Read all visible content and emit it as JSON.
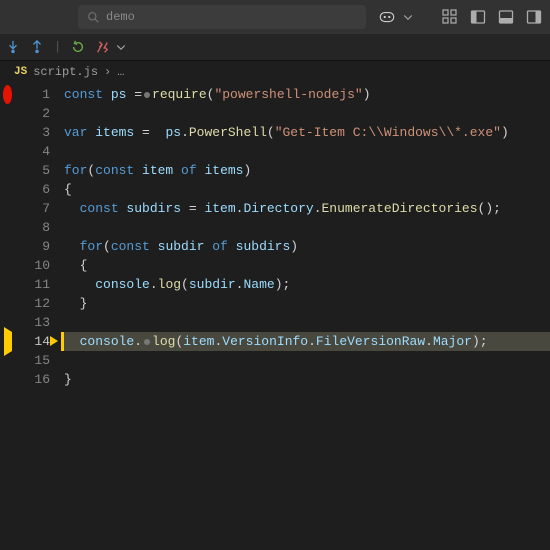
{
  "top": {
    "search_placeholder": "demo",
    "copilot_icon": "copilot-icon"
  },
  "debug_toolbar": {
    "items": [
      "step-into",
      "step-out",
      "restart",
      "disconnect"
    ]
  },
  "breadcrumb": {
    "file_icon": "JS",
    "file_name": "script.js",
    "separator": "›",
    "more": "…"
  },
  "editor": {
    "line_numbers": [
      "1",
      "2",
      "3",
      "4",
      "5",
      "6",
      "7",
      "8",
      "9",
      "10",
      "11",
      "12",
      "13",
      "14",
      "15",
      "16"
    ],
    "current_line": 14,
    "breakpoints": {
      "1": "red",
      "14": "current"
    },
    "code": {
      "l1": {
        "raw": "const ps =◦require(\"powershell-nodejs\")",
        "tokens": [
          [
            "kw",
            "const "
          ],
          [
            "var",
            "ps"
          ],
          [
            "pn",
            " ="
          ],
          [
            "dot",
            ""
          ],
          [
            "fn",
            "require"
          ],
          [
            "pn",
            "("
          ],
          [
            "str",
            "\"powershell-nodejs\""
          ],
          [
            "pn",
            ")"
          ]
        ]
      },
      "l2": {
        "raw": "",
        "tokens": []
      },
      "l3": {
        "raw": "var items =  ps.PowerShell(\"Get-Item C:\\\\Windows\\\\*.exe\")",
        "tokens": [
          [
            "kw",
            "var "
          ],
          [
            "var",
            "items"
          ],
          [
            "pn",
            " =  "
          ],
          [
            "var",
            "ps"
          ],
          [
            "pn",
            "."
          ],
          [
            "fn",
            "PowerShell"
          ],
          [
            "pn",
            "("
          ],
          [
            "str",
            "\"Get-Item C:\\\\Windows\\\\*.exe\""
          ],
          [
            "pn",
            ")"
          ]
        ]
      },
      "l4": {
        "raw": "",
        "tokens": []
      },
      "l5": {
        "raw": "for(const item of items)",
        "tokens": [
          [
            "kw",
            "for"
          ],
          [
            "pn",
            "("
          ],
          [
            "kw",
            "const "
          ],
          [
            "var",
            "item"
          ],
          [
            "kw",
            " of "
          ],
          [
            "var",
            "items"
          ],
          [
            "pn",
            ")"
          ]
        ]
      },
      "l6": {
        "raw": "{",
        "tokens": [
          [
            "pn",
            "{"
          ]
        ]
      },
      "l7": {
        "raw": "  const subdirs = item.Directory.EnumerateDirectories();",
        "tokens": [
          [
            "pn",
            "  "
          ],
          [
            "kw",
            "const "
          ],
          [
            "var",
            "subdirs"
          ],
          [
            "pn",
            " = "
          ],
          [
            "var",
            "item"
          ],
          [
            "pn",
            "."
          ],
          [
            "prop",
            "Directory"
          ],
          [
            "pn",
            "."
          ],
          [
            "fn",
            "EnumerateDirectories"
          ],
          [
            "pn",
            "();"
          ]
        ]
      },
      "l8": {
        "raw": "",
        "tokens": []
      },
      "l9": {
        "raw": "  for(const subdir of subdirs)",
        "tokens": [
          [
            "pn",
            "  "
          ],
          [
            "kw",
            "for"
          ],
          [
            "pn",
            "("
          ],
          [
            "kw",
            "const "
          ],
          [
            "var",
            "subdir"
          ],
          [
            "kw",
            " of "
          ],
          [
            "var",
            "subdirs"
          ],
          [
            "pn",
            ")"
          ]
        ]
      },
      "l10": {
        "raw": "  {",
        "tokens": [
          [
            "pn",
            "  {"
          ]
        ]
      },
      "l11": {
        "raw": "    console.log(subdir.Name);",
        "tokens": [
          [
            "pn",
            "    "
          ],
          [
            "var",
            "console"
          ],
          [
            "pn",
            "."
          ],
          [
            "fn",
            "log"
          ],
          [
            "pn",
            "("
          ],
          [
            "var",
            "subdir"
          ],
          [
            "pn",
            "."
          ],
          [
            "prop",
            "Name"
          ],
          [
            "pn",
            ");"
          ]
        ]
      },
      "l12": {
        "raw": "  }",
        "tokens": [
          [
            "pn",
            "  }"
          ]
        ]
      },
      "l13": {
        "raw": "",
        "tokens": []
      },
      "l14": {
        "raw": "  console.◦log(item.VersionInfo.FileVersionRaw.Major);",
        "tokens": [
          [
            "pn",
            "  "
          ],
          [
            "var",
            "console"
          ],
          [
            "pn",
            "."
          ],
          [
            "dot",
            ""
          ],
          [
            "fn",
            "log"
          ],
          [
            "pn",
            "("
          ],
          [
            "var",
            "item"
          ],
          [
            "pn",
            "."
          ],
          [
            "prop",
            "VersionInfo"
          ],
          [
            "pn",
            "."
          ],
          [
            "prop",
            "FileVersionRaw"
          ],
          [
            "pn",
            "."
          ],
          [
            "prop",
            "Major"
          ],
          [
            "pn",
            ");"
          ]
        ]
      },
      "l15": {
        "raw": "",
        "tokens": []
      },
      "l16": {
        "raw": "}",
        "tokens": [
          [
            "pn",
            "}"
          ]
        ]
      }
    }
  }
}
